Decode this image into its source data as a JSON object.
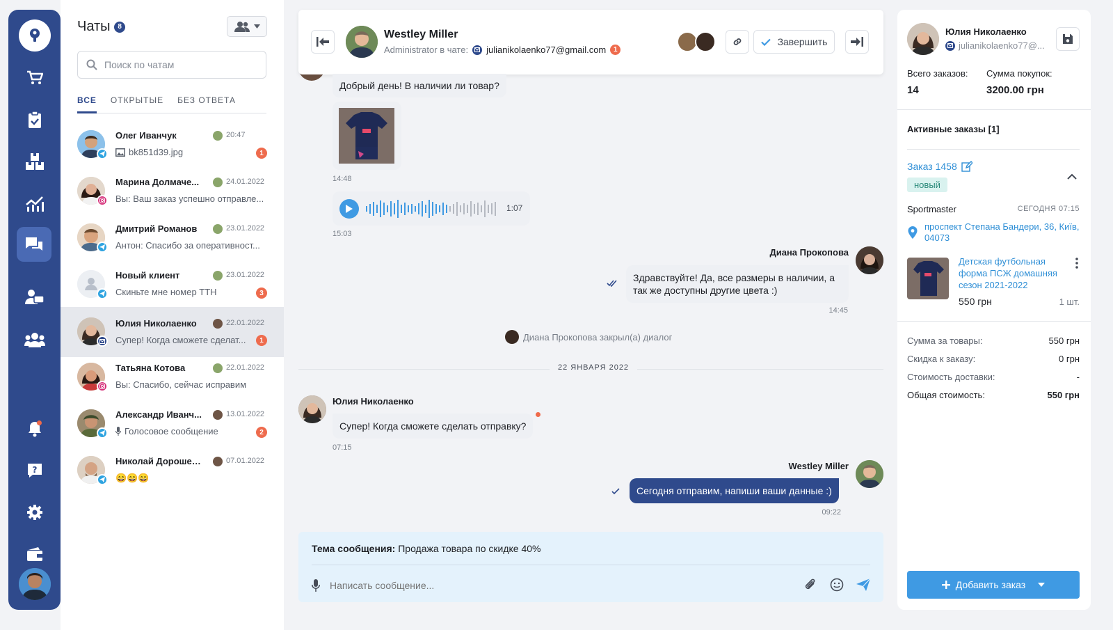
{
  "chats_panel": {
    "title": "Чаты",
    "title_count": "8",
    "search_placeholder": "Поиск по чатам",
    "tabs": [
      {
        "label": "ВСЕ",
        "active": true
      },
      {
        "label": "ОТКРЫТЫЕ",
        "active": false
      },
      {
        "label": "БЕЗ ОТВЕТА",
        "active": false
      }
    ],
    "items": [
      {
        "name": "Олег Иванчук",
        "time": "20:47",
        "preview": "bk851d39.jpg",
        "preview_icon": "image-icon",
        "unread": "1",
        "channel": "telegram"
      },
      {
        "name": "Марина Долмаче...",
        "time": "24.01.2022",
        "preview": "Вы: Ваш заказ успешно отправле...",
        "unread": "",
        "channel": "instagram"
      },
      {
        "name": "Дмитрий Романов",
        "time": "23.01.2022",
        "preview": "Антон: Спасибо за оперативност...",
        "unread": "",
        "channel": "telegram"
      },
      {
        "name": "Новый клиент",
        "time": "23.01.2022",
        "preview": "Скиньте мне номер ТТН",
        "unread": "3",
        "channel": "telegram"
      },
      {
        "name": "Юлия Николаенко",
        "time": "22.01.2022",
        "preview": "Супер! Когда сможете сделат...",
        "unread": "1",
        "channel": "email",
        "selected": true
      },
      {
        "name": "Татьяна Котова",
        "time": "22.01.2022",
        "preview": "Вы: Спасибо, сейчас исправим",
        "unread": "",
        "channel": "instagram"
      },
      {
        "name": "Александр Иванч...",
        "time": "13.01.2022",
        "preview": "Голосовое сообщение",
        "preview_icon": "microphone-icon",
        "unread": "2",
        "channel": "telegram"
      },
      {
        "name": "Николай Дорошен...",
        "time": "07.01.2022",
        "preview": "😄😄😄",
        "unread": "",
        "channel": "telegram"
      }
    ]
  },
  "chat_header": {
    "name": "Westley Miller",
    "admin_label": "Administrator в чате:",
    "email": "julianikolaenko77@gmail.com",
    "email_badge": "1",
    "finish_label": "Завершить"
  },
  "messages": {
    "m1_text": "Добрый день! В наличии ли товар?",
    "m2_time": "14:48",
    "voice_duration": "1:07",
    "voice_time": "15:03",
    "m4_sender": "Диана Прокопова",
    "m4_text": "Здравствуйте! Да, все размеры в наличии, а так же доступны другие цвета :)",
    "m4_time": "14:45",
    "system_text": "Диана Прокопова закрыл(а) диалог",
    "date_divider": "22 ЯНВАРЯ 2022",
    "m5_sender": "Юлия Николаенко",
    "m5_text": "Супер! Когда сможете сделать отправку?",
    "m5_time": "07:15",
    "m6_sender": "Westley Miller",
    "m6_text": "Сегодня отправим, напиши ваши данные :)",
    "m6_time": "09:22"
  },
  "composer": {
    "subject_label": "Тема сообщения:",
    "subject_value": "Продажа товара по скидке 40%",
    "placeholder": "Написать сообщение..."
  },
  "customer": {
    "name": "Юлия Николаенко",
    "email": "julianikolaenko77@...",
    "orders_label": "Всего заказов:",
    "orders_value": "14",
    "sum_label": "Сумма покупок:",
    "sum_value": "3200.00 грн",
    "active_orders": "Активные заказы [1]",
    "order_label": "Заказ 1458",
    "order_status": "новый",
    "store": "Sportmaster",
    "order_time": "СЕГОДНЯ 07:15",
    "address": "проспект Степана Бандери, 36, Київ, 04073",
    "product_name": "Детская футбольная форма ПСЖ домашняя сезон 2021-2022",
    "product_price": "550 грн",
    "product_qty": "1 шт.",
    "summary": [
      {
        "label": "Сумма за товары:",
        "value": "550 грн"
      },
      {
        "label": "Скидка к заказу:",
        "value": "0 грн"
      },
      {
        "label": "Стоимость доставки:",
        "value": "-"
      },
      {
        "label": "Общая стоимость:",
        "value": "550 грн"
      }
    ],
    "add_order_label": "Добавить заказ"
  },
  "colors": {
    "nav": "#2f4a8c",
    "accent": "#3f9ae3",
    "badge": "#ee6b4d",
    "outgoing": "#2f4a8c"
  }
}
